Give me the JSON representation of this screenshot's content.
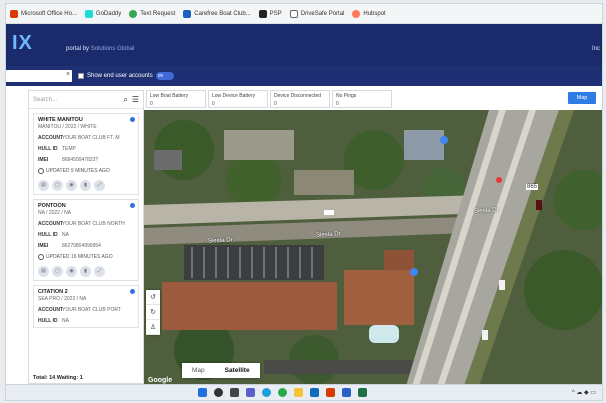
{
  "bookmarks": [
    {
      "label": "Microsoft Office Ho...",
      "color": "#d83b01"
    },
    {
      "label": "GoDaddy",
      "color": "#1bdbdb"
    },
    {
      "label": "Text Request",
      "color": "#34a853"
    },
    {
      "label": "Carefree Boat Club...",
      "color": "#1f5fbf"
    },
    {
      "label": "PSP",
      "color": "#222222"
    },
    {
      "label": "DriveSafe Portal",
      "color": "#666666"
    },
    {
      "label": "Hubspot",
      "color": "#ff7a59"
    }
  ],
  "header": {
    "logo": "IX",
    "portal": "portal by",
    "portal_by": "Solutions Global",
    "right_text": "Inc"
  },
  "filters": {
    "show_end_user_label": "Show end user accounts",
    "toggle_text": "on",
    "right_text": "Inc"
  },
  "sidebar": {
    "search_placeholder": "Search...",
    "cards": [
      {
        "name": "WHITE MANITOU",
        "sub": "MANITOU / 2022 / WHITE",
        "account_key": "ACCOUNT",
        "account": "YOUR BOAT CLUB FT. M",
        "hull_key": "HULL ID",
        "hull": "TEMP",
        "imei_key": "IMEI",
        "imei": "868450047823?",
        "updated": "UPDATED 9 MINUTES AGO"
      },
      {
        "name": "PONTOON",
        "sub": "NA / 2022 / NA",
        "account_key": "ACCOUNT",
        "account": "YOUR BOAT CLUB NORTH",
        "hull_key": "HULL ID",
        "hull": "NA",
        "imei_key": "IMEI",
        "imei": "86270804999954",
        "updated": "UPDATED 16 MINUTES AGO"
      },
      {
        "name": "CITATION 2",
        "sub": "SEA PRO / 2022 / NA",
        "account_key": "ACCOUNT",
        "account": "YOUR BOAT CLUB PORT",
        "hull_key": "HULL ID",
        "hull": "NA"
      }
    ],
    "totals": "Total: 14   Waiting: 1"
  },
  "stats": [
    {
      "title": "Low Boat Battery",
      "value": "0"
    },
    {
      "title": "Low Device Battery",
      "value": "0"
    },
    {
      "title": "Device Disconnected",
      "value": "0"
    },
    {
      "title": "No Pings",
      "value": "0"
    }
  ],
  "map": {
    "button": "Map",
    "type_map": "Map",
    "type_satellite": "Satellite",
    "google": "Google",
    "streets": [
      "Siesta Dr",
      "Siesta Dr",
      "Siesta Dr"
    ],
    "highway": "865"
  },
  "taskbar": {
    "tray": "^ ☁ ◆ ▭"
  }
}
